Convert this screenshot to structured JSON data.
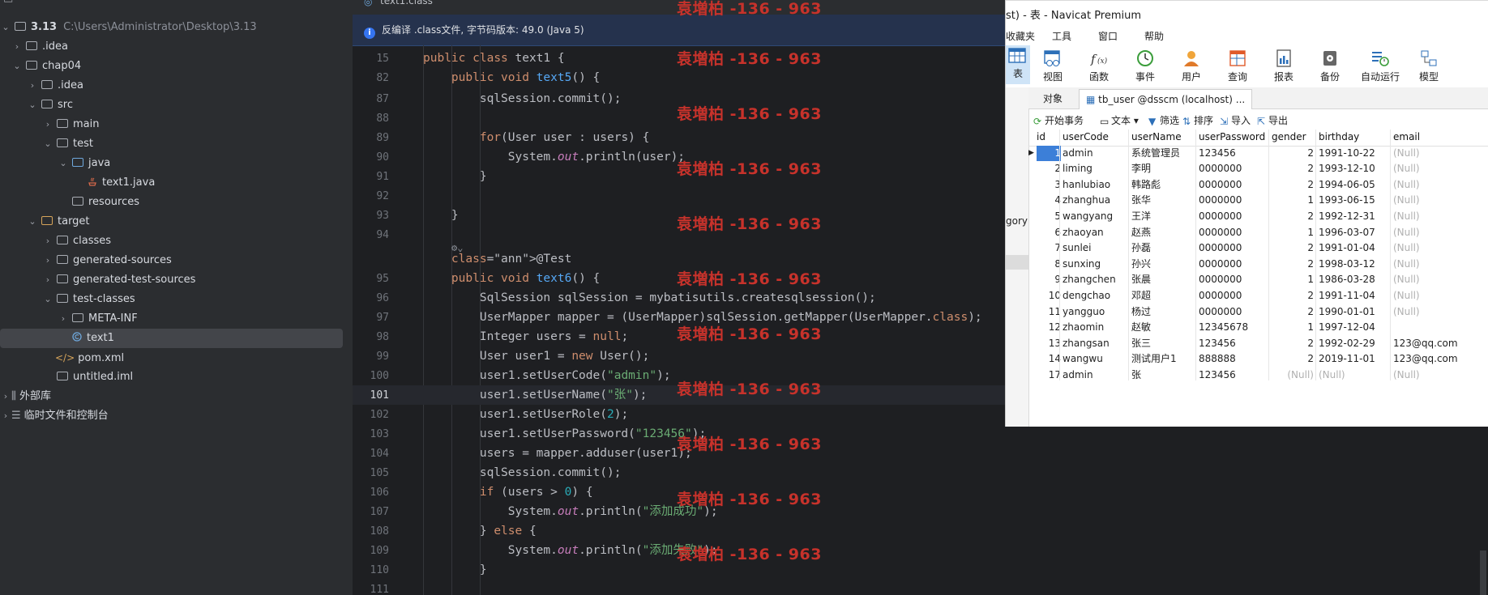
{
  "project_tree": {
    "root": {
      "name": "3.13",
      "path": "C:\\Users\\Administrator\\Desktop\\3.13"
    },
    "items": [
      {
        "label": ".idea"
      },
      {
        "label": "chap04"
      },
      {
        "label": ".idea"
      },
      {
        "label": "src"
      },
      {
        "label": "main"
      },
      {
        "label": "test"
      },
      {
        "label": "java"
      },
      {
        "label": "text1.java"
      },
      {
        "label": "resources"
      },
      {
        "label": "target"
      },
      {
        "label": "classes"
      },
      {
        "label": "generated-sources"
      },
      {
        "label": "generated-test-sources"
      },
      {
        "label": "test-classes"
      },
      {
        "label": "META-INF"
      },
      {
        "label": "text1"
      },
      {
        "label": "pom.xml"
      },
      {
        "label": "untitled.iml"
      },
      {
        "label": "外部库"
      },
      {
        "label": "临时文件和控制台"
      }
    ]
  },
  "editor": {
    "tab": "text1.class",
    "info_bar": "反编译 .class文件, 字节码版本: 49.0 (Java 5)",
    "lines": [
      {
        "n": "15",
        "code": "public class text1 {"
      },
      {
        "n": "82",
        "code": "    public void text5() {"
      },
      {
        "n": "87",
        "code": "        sqlSession.commit();"
      },
      {
        "n": "88",
        "code": ""
      },
      {
        "n": "89",
        "code": "        for(User user : users) {"
      },
      {
        "n": "90",
        "code": "            System.out.println(user);"
      },
      {
        "n": "91",
        "code": "        }"
      },
      {
        "n": "92",
        "code": ""
      },
      {
        "n": "93",
        "code": "    }"
      },
      {
        "n": "94",
        "code": ""
      },
      {
        "n": "",
        "code": "    @Test"
      },
      {
        "n": "95",
        "code": "    public void text6() {"
      },
      {
        "n": "96",
        "code": "        SqlSession sqlSession = mybatisutils.createsqlsession();"
      },
      {
        "n": "97",
        "code": "        UserMapper mapper = (UserMapper)sqlSession.getMapper(UserMapper.class);"
      },
      {
        "n": "98",
        "code": "        Integer users = null;"
      },
      {
        "n": "99",
        "code": "        User user1 = new User();"
      },
      {
        "n": "100",
        "code": "        user1.setUserCode(\"admin\");"
      },
      {
        "n": "101",
        "code": "        user1.setUserName(\"张\");"
      },
      {
        "n": "102",
        "code": "        user1.setUserRole(2);"
      },
      {
        "n": "103",
        "code": "        user1.setUserPassword(\"123456\");"
      },
      {
        "n": "104",
        "code": "        users = mapper.adduser(user1);"
      },
      {
        "n": "105",
        "code": "        sqlSession.commit();"
      },
      {
        "n": "106",
        "code": "        if (users > 0) {"
      },
      {
        "n": "107",
        "code": "            System.out.println(\"添加成功\");"
      },
      {
        "n": "108",
        "code": "        } else {"
      },
      {
        "n": "109",
        "code": "            System.out.println(\"添加失败\");"
      },
      {
        "n": "110",
        "code": "        }"
      },
      {
        "n": "111",
        "code": ""
      }
    ],
    "watermark": "袁増柏 -136 - 963"
  },
  "navicat": {
    "title": "st) - 表 - Navicat Premium",
    "menu": [
      "收藏夹",
      "工具",
      "窗口",
      "帮助"
    ],
    "toolbar": [
      "表",
      "视图",
      "函数",
      "事件",
      "用户",
      "查询",
      "报表",
      "备份",
      "自动运行",
      "模型"
    ],
    "tabs": {
      "objects": "对象",
      "table": "tb_user @dsscm (localhost) ..."
    },
    "side_label": "gory",
    "actions": {
      "begin": "开始事务",
      "text": "文本",
      "filter": "筛选",
      "sort": "排序",
      "import": "导入",
      "export": "导出"
    },
    "columns": [
      "id",
      "userCode",
      "userName",
      "userPassword",
      "gender",
      "birthday",
      "email"
    ],
    "rows": [
      [
        "1",
        "admin",
        "系统管理员",
        "123456",
        "2",
        "1991-10-22",
        "(Null)"
      ],
      [
        "2",
        "liming",
        "李明",
        "0000000",
        "2",
        "1993-12-10",
        "(Null)"
      ],
      [
        "3",
        "hanlubiao",
        "韩路彪",
        "0000000",
        "2",
        "1994-06-05",
        "(Null)"
      ],
      [
        "4",
        "zhanghua",
        "张华",
        "0000000",
        "1",
        "1993-06-15",
        "(Null)"
      ],
      [
        "5",
        "wangyang",
        "王洋",
        "0000000",
        "2",
        "1992-12-31",
        "(Null)"
      ],
      [
        "6",
        "zhaoyan",
        "赵燕",
        "0000000",
        "1",
        "1996-03-07",
        "(Null)"
      ],
      [
        "7",
        "sunlei",
        "孙磊",
        "0000000",
        "2",
        "1991-01-04",
        "(Null)"
      ],
      [
        "8",
        "sunxing",
        "孙兴",
        "0000000",
        "2",
        "1998-03-12",
        "(Null)"
      ],
      [
        "9",
        "zhangchen",
        "张晨",
        "0000000",
        "1",
        "1986-03-28",
        "(Null)"
      ],
      [
        "10",
        "dengchao",
        "邓超",
        "0000000",
        "2",
        "1991-11-04",
        "(Null)"
      ],
      [
        "11",
        "yangguo",
        "杨过",
        "0000000",
        "2",
        "1990-01-01",
        "(Null)"
      ],
      [
        "12",
        "zhaomin",
        "赵敏",
        "12345678",
        "1",
        "1997-12-04",
        ""
      ],
      [
        "13",
        "zhangsan",
        "张三",
        "123456",
        "2",
        "1992-02-29",
        "123@qq.com"
      ],
      [
        "14",
        "wangwu",
        "测试用户1",
        "888888",
        "2",
        "2019-11-01",
        "123@qq.com"
      ],
      [
        "17",
        "admin",
        "张",
        "123456",
        "(Null)",
        "(Null)",
        "(Null)"
      ]
    ]
  }
}
